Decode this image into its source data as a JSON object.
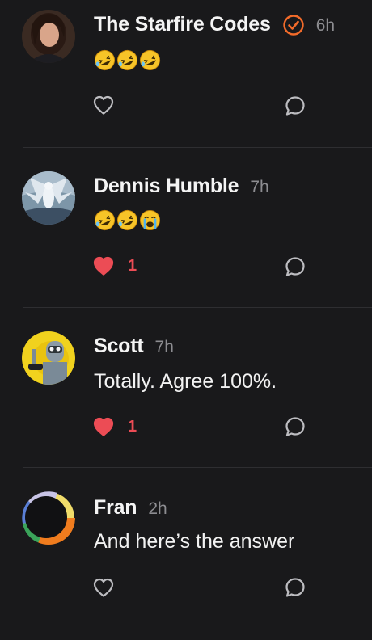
{
  "accent": "#f26b2a",
  "like_color": "#ec4c55",
  "comments": [
    {
      "name": "The Starfire Codes",
      "verified": true,
      "time": "6h",
      "content_type": "emoji",
      "emojis": [
        "rolling-on-floor-laughing",
        "rolling-on-floor-laughing",
        "rolling-on-floor-laughing"
      ],
      "liked": false,
      "like_count": ""
    },
    {
      "name": "Dennis Humble",
      "verified": false,
      "time": "7h",
      "content_type": "emoji",
      "emojis": [
        "rolling-on-floor-laughing",
        "rolling-on-floor-laughing",
        "loudly-crying"
      ],
      "liked": true,
      "like_count": "1"
    },
    {
      "name": "Scott",
      "verified": false,
      "time": "7h",
      "content_type": "text",
      "text": "Totally. Agree 100%.",
      "liked": true,
      "like_count": "1"
    },
    {
      "name": "Fran",
      "verified": false,
      "time": "2h",
      "content_type": "text",
      "text": "And here’s the answer",
      "liked": false,
      "like_count": ""
    }
  ],
  "icons": {
    "like": "heart-icon",
    "reply": "speech-bubble-icon",
    "verified": "verified-check-icon"
  }
}
